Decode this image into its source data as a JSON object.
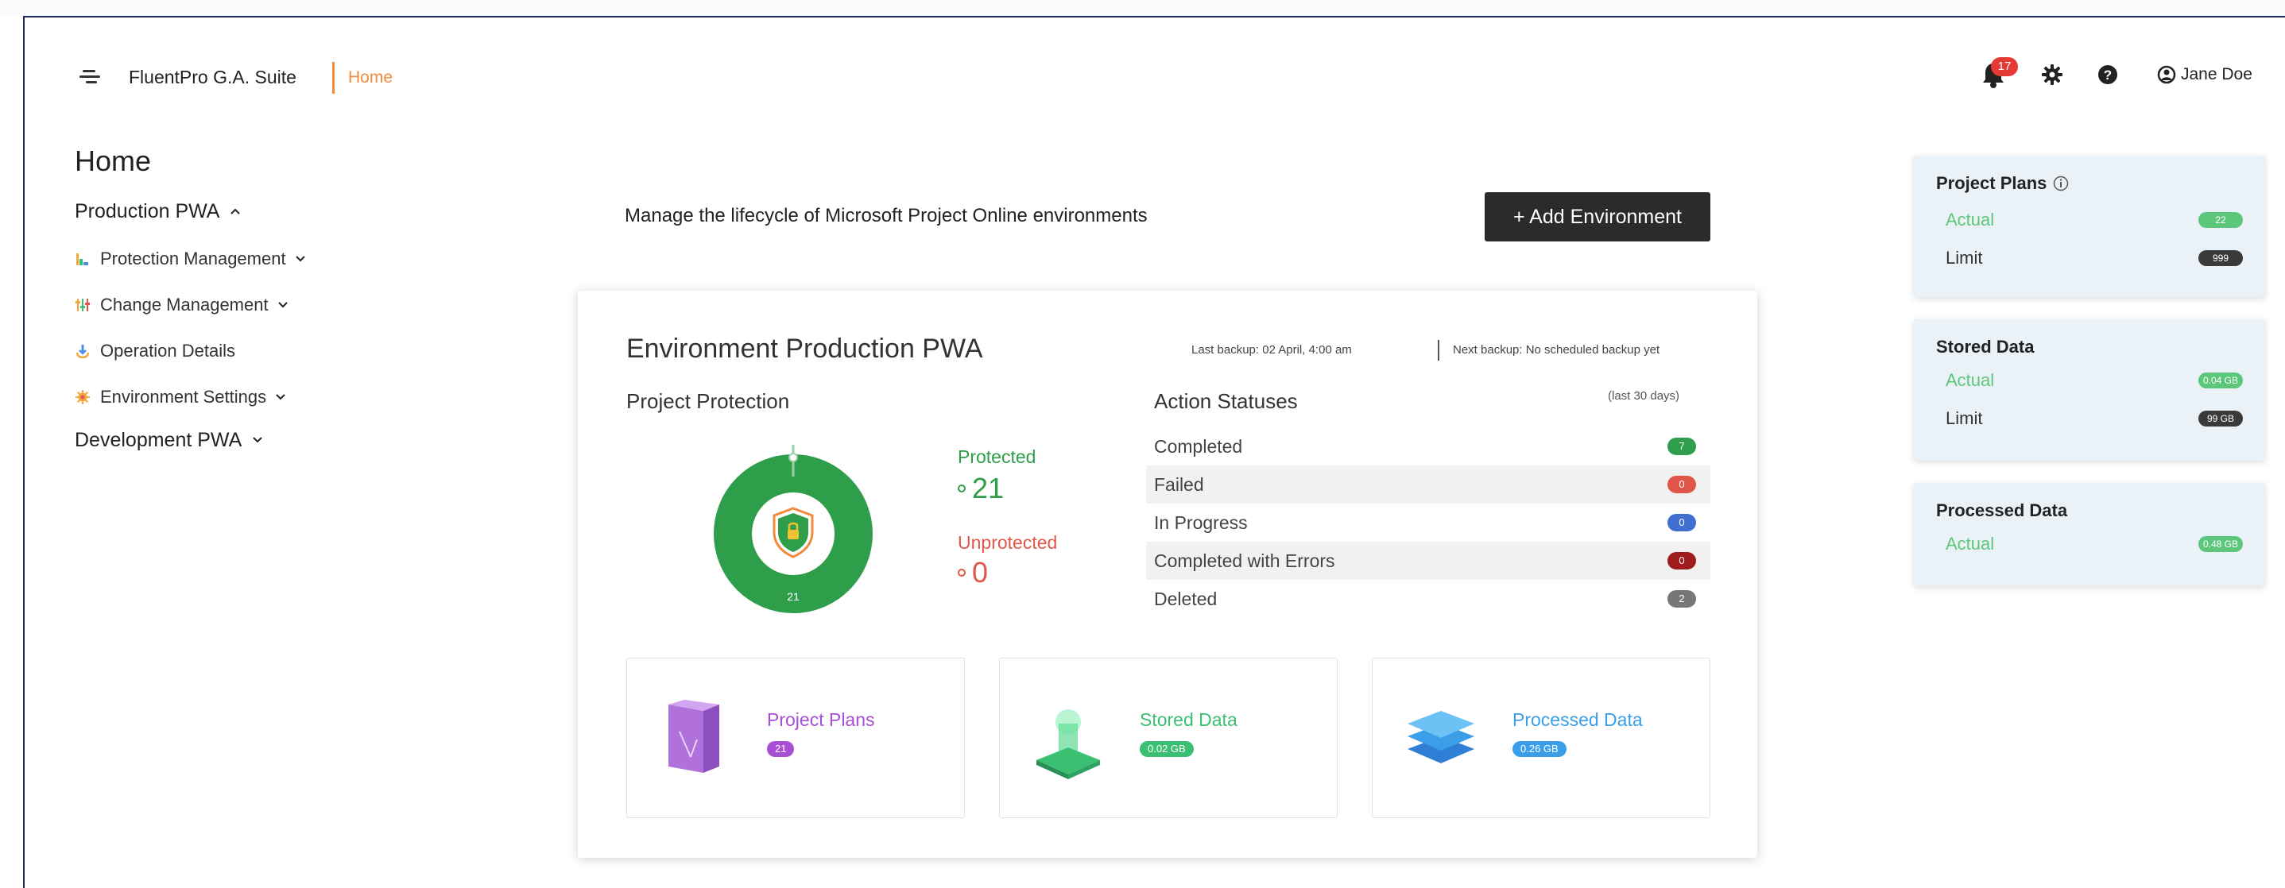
{
  "header": {
    "app_name": "FluentPro G.A. Suite",
    "breadcrumb": "Home",
    "notifications_count": "17",
    "user_name": "Jane Doe"
  },
  "sidebar": {
    "page_title": "Home",
    "groups": [
      {
        "label": "Production PWA",
        "expanded": true,
        "items": [
          {
            "label": "Protection Management",
            "icon": "chart-icon"
          },
          {
            "label": "Change Management",
            "icon": "sliders-icon"
          },
          {
            "label": "Operation Details",
            "icon": "operations-icon"
          },
          {
            "label": "Environment Settings",
            "icon": "gear-icon"
          }
        ]
      },
      {
        "label": "Development PWA",
        "expanded": false
      }
    ]
  },
  "main": {
    "description": "Manage the lifecycle of Microsoft Project Online environments",
    "add_button": "+ Add Environment",
    "environment": {
      "title": "Environment Production PWA",
      "last_backup": "Last backup: 02 April, 4:00 am",
      "next_backup": "Next backup: No scheduled backup yet",
      "project_protection": {
        "title": "Project Protection",
        "donut_center": "21",
        "protected_label": "Protected",
        "protected_value": "21",
        "unprotected_label": "Unprotected",
        "unprotected_value": "0"
      },
      "action_statuses": {
        "title": "Action Statuses",
        "period": "(last 30 days)",
        "rows": [
          {
            "label": "Completed",
            "value": "7",
            "color": "#2e9e4a"
          },
          {
            "label": "Failed",
            "value": "0",
            "color": "#e2564a"
          },
          {
            "label": "In Progress",
            "value": "0",
            "color": "#3f6fd1"
          },
          {
            "label": "Completed with Errors",
            "value": "0",
            "color": "#a01c1c"
          },
          {
            "label": "Deleted",
            "value": "2",
            "color": "#777777"
          }
        ]
      },
      "stats": [
        {
          "label": "Project Plans",
          "value": "21",
          "color": "#a84fd6"
        },
        {
          "label": "Stored Data",
          "value": "0.02 GB",
          "color": "#3bbf72"
        },
        {
          "label": "Processed Data",
          "value": "0.26 GB",
          "color": "#3a9fe8"
        }
      ]
    }
  },
  "right_panels": {
    "project_plans": {
      "title": "Project Plans",
      "actual_label": "Actual",
      "actual_value": "22",
      "limit_label": "Limit",
      "limit_value": "999"
    },
    "stored_data": {
      "title": "Stored Data",
      "actual_label": "Actual",
      "actual_value": "0.04 GB",
      "limit_label": "Limit",
      "limit_value": "99 GB"
    },
    "processed_data": {
      "title": "Processed Data",
      "actual_label": "Actual",
      "actual_value": "0.48 GB"
    }
  },
  "colors": {
    "accent_orange": "#f08a3c",
    "protected_green": "#2e9e4a",
    "unprotected_red": "#e2564a",
    "actual_green": "#5cc77a",
    "limit_dark": "#3a3a3a"
  }
}
